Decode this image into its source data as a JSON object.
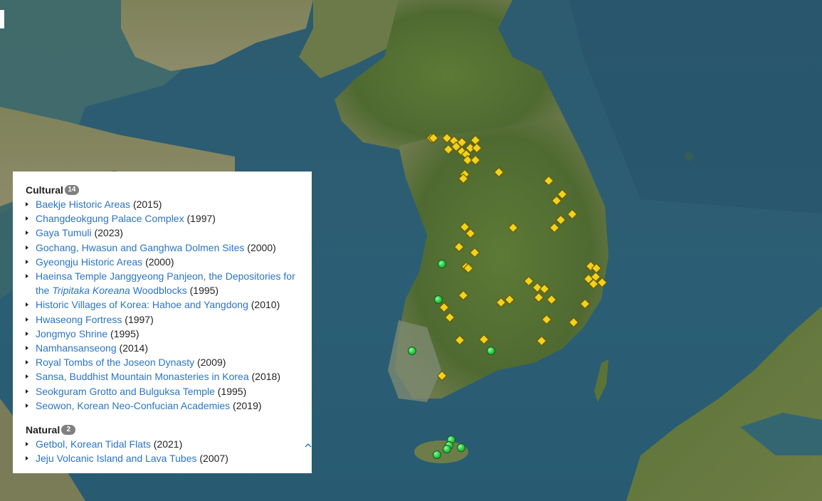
{
  "legend": {
    "cultural": {
      "title": "Cultural",
      "count": "14",
      "items": [
        {
          "name": "Baekje Historic Areas",
          "year": "(2015)"
        },
        {
          "name": "Changdeokgung Palace Complex",
          "year": "(1997)"
        },
        {
          "name": "Gaya Tumuli",
          "year": "(2023)"
        },
        {
          "name": "Gochang, Hwasun and Ganghwa Dolmen Sites",
          "year": "(2000)"
        },
        {
          "name": "Gyeongju Historic Areas",
          "year": "(2000)"
        },
        {
          "name_pre": "Haeinsa Temple Janggyeong Panjeon, the Depositories for the ",
          "name_em": "Tripitaka Koreana",
          "name_post": " Woodblocks",
          "year": "(1995)"
        },
        {
          "name": "Historic Villages of Korea: Hahoe and Yangdong",
          "year": "(2010)"
        },
        {
          "name": "Hwaseong Fortress",
          "year": "(1997)"
        },
        {
          "name": "Jongmyo Shrine",
          "year": "(1995)"
        },
        {
          "name": "Namhansanseong",
          "year": "(2014)"
        },
        {
          "name": "Royal Tombs of the Joseon Dynasty",
          "year": "(2009)"
        },
        {
          "name": "Sansa, Buddhist Mountain Monasteries in Korea",
          "year": "(2018)"
        },
        {
          "name": "Seokguram Grotto and Bulguksa Temple",
          "year": "(1995)"
        },
        {
          "name": "Seowon, Korean Neo-Confucian Academies",
          "year": "(2019)"
        }
      ]
    },
    "natural": {
      "title": "Natural",
      "count": "2",
      "items": [
        {
          "name": "Getbol, Korean Tidal Flats",
          "year": "(2021)"
        },
        {
          "name": "Jeju Volcanic Island and Lava Tubes",
          "year": "(2007)"
        }
      ]
    },
    "collapse_icon": "chevron-up-icon"
  },
  "map": {
    "colors": {
      "sea": "#2d5b70",
      "land": "#5f7a3a",
      "cultural_marker": "#f2d21b",
      "natural_marker": "#2fd14a"
    },
    "marker_counts": {
      "cultural": 62,
      "natural": 9
    }
  }
}
